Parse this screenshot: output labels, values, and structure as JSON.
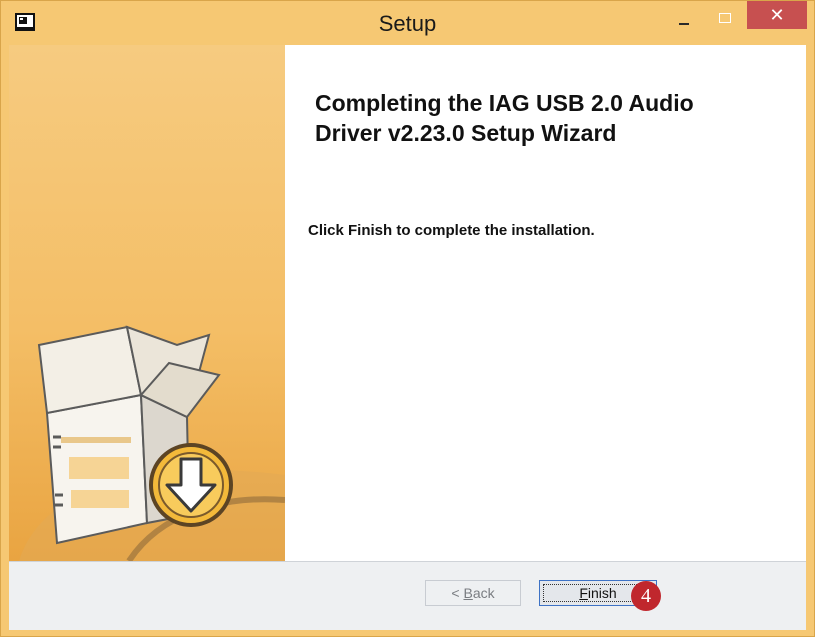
{
  "window": {
    "title": "Setup",
    "close_symbol": "✕",
    "accent_color": "#f6c873"
  },
  "wizard": {
    "heading_line1": "Completing the IAG USB 2.0 Audio",
    "heading_line2": "Driver v2.23.0 Setup Wizard",
    "message": "Click Finish to complete the installation.",
    "banner_icon": "package-download-icon"
  },
  "buttons": {
    "back_access_key": "B",
    "back_rest": "ack",
    "back_prefix": "< ",
    "finish_access_key": "F",
    "finish_rest": "inish"
  },
  "annotation": {
    "step_number": "4",
    "color": "#c0272d"
  }
}
